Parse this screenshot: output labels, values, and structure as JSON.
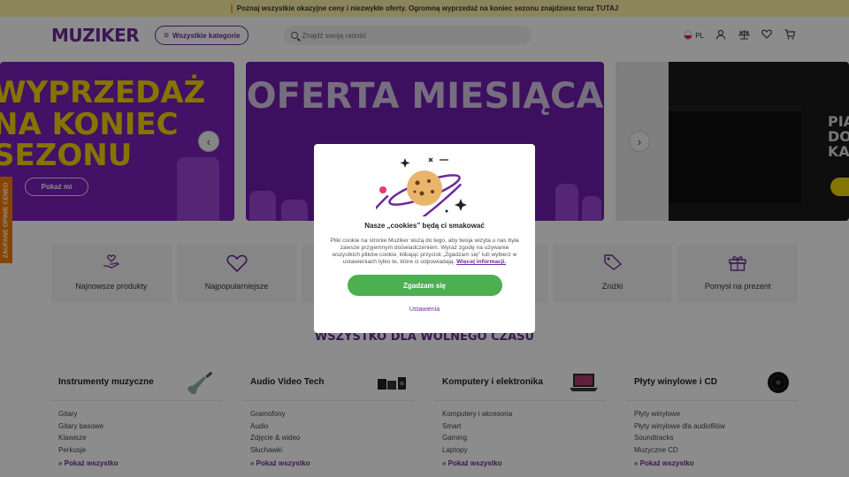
{
  "promo": {
    "text": "Poznaj wszystkie okazyjne ceny i niezwykłe oferty. Ogromną wyprzedaż na koniec sezonu znajdziesz teraz TUTAJ"
  },
  "header": {
    "logo": "MUZIKER",
    "categories_button": "Wszystkie kategorie",
    "search_placeholder": "Znajdź swoją radość",
    "language": "PL",
    "icons": [
      "flag-pl-icon",
      "user-icon",
      "scale-icon",
      "heart-icon",
      "cart-icon"
    ]
  },
  "banners": [
    {
      "title": "WYPRZEDAŻ NA KONIEC SEZONU",
      "button": "Pokaż mi"
    },
    {
      "title": "OFERTA MIESIĄCA",
      "button": ""
    },
    {
      "title": "PIA DO KA",
      "button": ""
    }
  ],
  "ceneo": {
    "label": "ZAUFANE OPINIE CENEO"
  },
  "tiles": [
    {
      "label": "Najnowsze produkty",
      "icon": "hand-heart-icon"
    },
    {
      "label": "Najpopularniejsze",
      "icon": "heart-icon"
    },
    {
      "label": "",
      "icon": ""
    },
    {
      "label": "",
      "icon": ""
    },
    {
      "label": "Zniżki",
      "icon": "tag-icon"
    },
    {
      "label": "Pomysł na prezent",
      "icon": "gift-icon"
    }
  ],
  "section_title": "WSZYSTKO DLA WOLNEGO CZASU",
  "categories": [
    {
      "title": "Instrumenty muzyczne",
      "items": [
        "Gitary",
        "Gitary basowe",
        "Klawisze",
        "Perkusje"
      ],
      "more": "Pokaż wszystko",
      "thumb": "guitar-icon"
    },
    {
      "title": "Audio Video Tech",
      "items": [
        "Gramofony",
        "Audio",
        "Zdjęcie & wideo",
        "Słuchawki"
      ],
      "more": "Pokaż wszystko",
      "thumb": "audio-gear-icon"
    },
    {
      "title": "Komputery i elektronika",
      "items": [
        "Komputery i akcesoria",
        "Smart",
        "Gaming",
        "Laptopy"
      ],
      "more": "Pokaż wszystko",
      "thumb": "laptop-icon"
    },
    {
      "title": "Płyty winylowe i CD",
      "items": [
        "Płyty winylowe",
        "Płyty winylowe dla audiofilów",
        "Soundtracks",
        "Muzyczne CD"
      ],
      "more": "Pokaż wszystko",
      "thumb": "vinyl-icon"
    }
  ],
  "cookie_modal": {
    "title": "Nasze „cookies” będą ci smakować",
    "body": "Pliki cookie na stronie Muziker służą do tego, aby twoja wizyta u nas była zawsze przyjemnym doświadczeniem. Wyraź zgodę na używanie wszystkich plików cookie, klikając przycisk „Zgadzam się” lub wybierz w ustawieniach tylko te, które ci odpowiadają.",
    "more_link": "Więcej informacji.",
    "accept_button": "Zgadzam się",
    "settings_link": "Ustawienia"
  },
  "colors": {
    "brand": "#6c2a99",
    "accept": "#4caf50",
    "promo_bg": "#fff3a8",
    "ceneo": "#f57c00"
  }
}
